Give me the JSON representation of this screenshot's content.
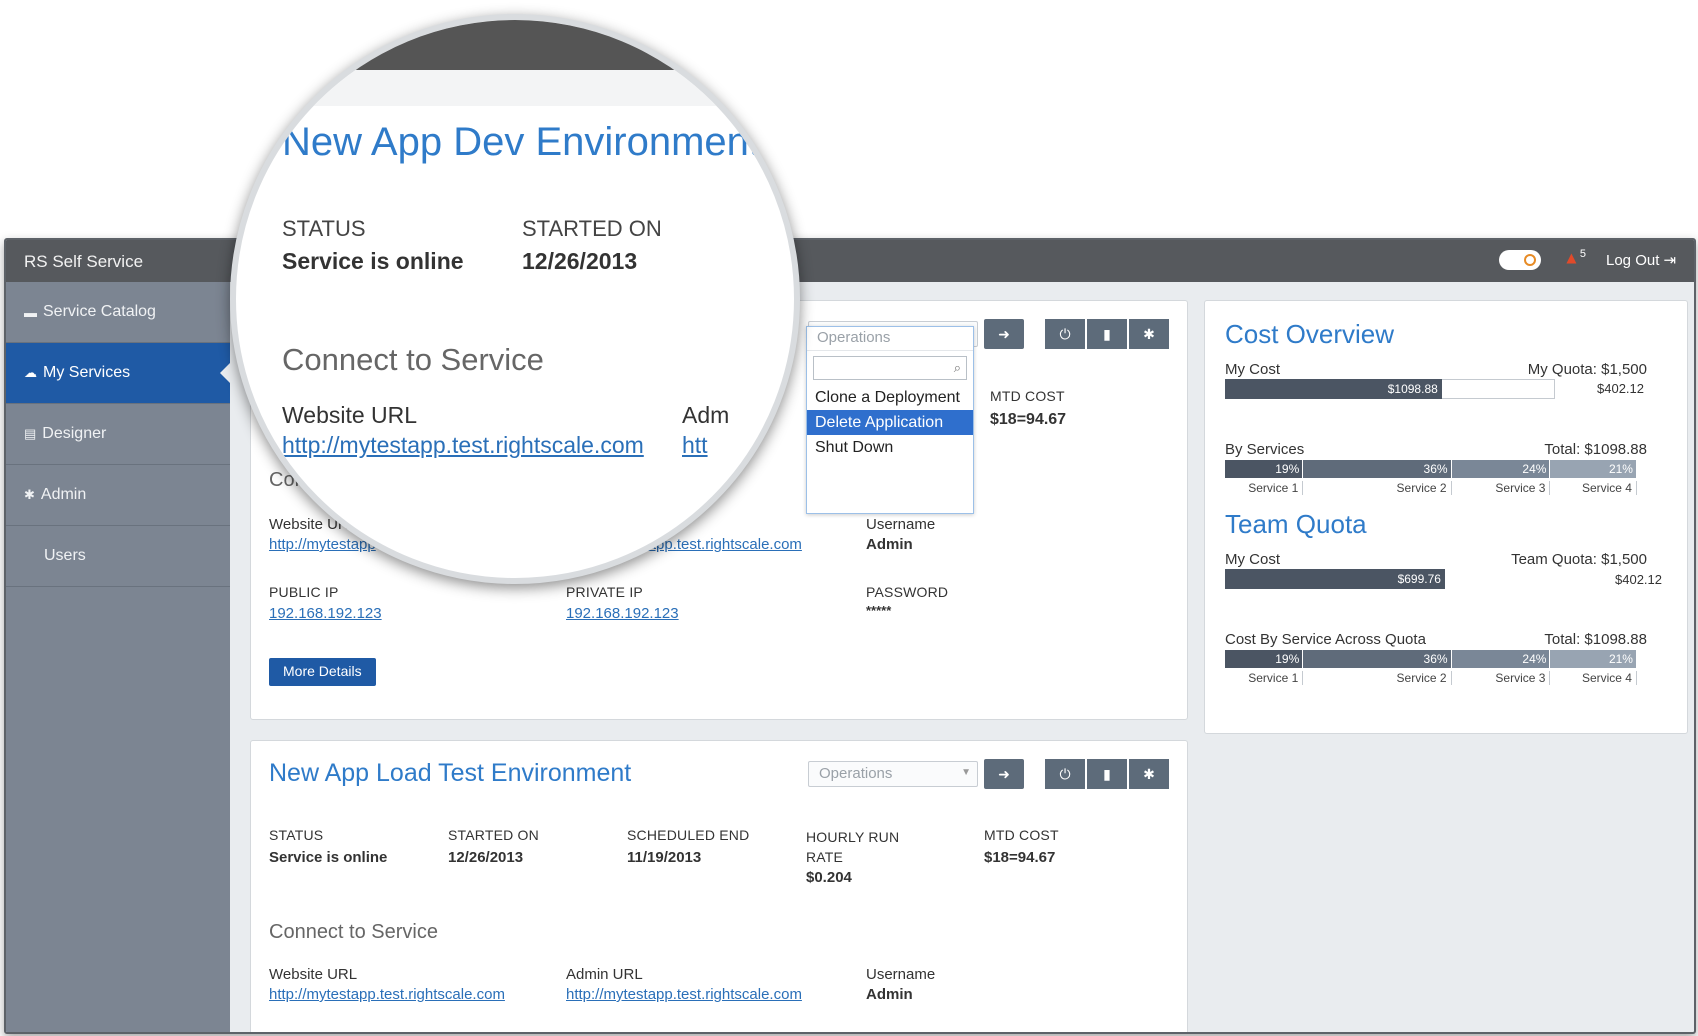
{
  "header": {
    "brand": "RS Self Service",
    "alert_count": "5",
    "logout": "Log Out"
  },
  "sidebar": {
    "items": [
      {
        "label": "Service Catalog",
        "icon": "catalog-icon"
      },
      {
        "label": "My Services",
        "icon": "cloud-icon",
        "active": true
      },
      {
        "label": "Designer",
        "icon": "map-icon"
      },
      {
        "label": "Admin",
        "icon": "gear-icon"
      },
      {
        "label": "Users"
      }
    ]
  },
  "magnifier": {
    "title": "New App Dev Environment",
    "status_label": "STATUS",
    "status_value": "Service is online",
    "started_label": "STARTED ON",
    "started_value": "12/26/2013",
    "connect_heading": "Connect to Service",
    "website_label": "Website URL",
    "website_url": "http://mytestapp.test.rightscale.com",
    "admin_label_partial": "Adm",
    "admin_url_partial": "htt"
  },
  "service1": {
    "ops_placeholder": "Operations",
    "mtd_cost_label": "MTD COST",
    "mtd_cost_value": "$18=94.67",
    "connect_partial": "Con",
    "website_label": "Website URL",
    "website_url_partial": "http://mytestapp",
    "admin_url_partial": "ytestapp.test.rightscale.com",
    "username_label": "Username",
    "username_value": "Admin",
    "public_ip_label": "PUBLIC IP",
    "public_ip": "192.168.192.123",
    "private_ip_label": "PRIVATE IP",
    "private_ip": "192.168.192.123",
    "password_label": "PASSWORD",
    "password_value": "*****",
    "more_details": "More Details"
  },
  "dropdown": {
    "items": [
      "Clone a Deployment",
      "Delete Application",
      "Shut Down"
    ],
    "selected": "Delete Application"
  },
  "service2": {
    "title": "New App Load Test Environment",
    "ops_placeholder": "Operations",
    "status_label": "STATUS",
    "status_value": "Service is online",
    "started_label": "STARTED ON",
    "started_value": "12/26/2013",
    "sched_end_label": "SCHEDULED END",
    "sched_end_value": "11/19/2013",
    "hourly_label": "HOURLY RUN RATE",
    "hourly_value": "$0.204",
    "mtd_label": "MTD COST",
    "mtd_value": "$18=94.67",
    "connect_heading": "Connect to Service",
    "website_label": "Website URL",
    "website_url": "http://mytestapp.test.rightscale.com",
    "admin_label": "Admin URL",
    "admin_url": "http://mytestapp.test.rightscale.com",
    "username_label": "Username",
    "username_value": "Admin"
  },
  "cost_overview": {
    "title": "Cost Overview",
    "my_cost_label": "My Cost",
    "quota_label": "My Quota: $1,500",
    "my_cost_value": "$1098.88",
    "remaining": "$402.12",
    "my_cost_fraction": 0.73,
    "by_services_label": "By Services",
    "total_label": "Total: $1098.88",
    "segments": [
      {
        "pct": "19%",
        "name": "Service 1",
        "share": 19,
        "color": "#4b5563"
      },
      {
        "pct": "36%",
        "name": "Service 2",
        "share": 36,
        "color": "#5f6b7a"
      },
      {
        "pct": "24%",
        "name": "Service 3",
        "share": 24,
        "color": "#7a8797"
      },
      {
        "pct": "21%",
        "name": "Service 4",
        "share": 21,
        "color": "#98a4b2"
      }
    ]
  },
  "team_quota": {
    "title": "Team Quota",
    "my_cost_label": "My Cost",
    "quota_label": "Team Quota: $1,500",
    "my_cost_value": "$699.76",
    "remaining": "$402.12",
    "my_cost_fraction": 0.47,
    "across_label": "Cost By Service Across Quota",
    "total_label": "Total: $1098.88",
    "segments": [
      {
        "pct": "19%",
        "name": "Service 1",
        "share": 19,
        "color": "#4b5563"
      },
      {
        "pct": "36%",
        "name": "Service 2",
        "share": 36,
        "color": "#5f6b7a"
      },
      {
        "pct": "24%",
        "name": "Service 3",
        "share": 24,
        "color": "#7a8797"
      },
      {
        "pct": "21%",
        "name": "Service 4",
        "share": 21,
        "color": "#98a4b2"
      }
    ]
  }
}
